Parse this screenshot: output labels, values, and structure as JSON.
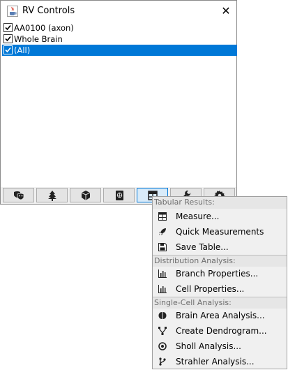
{
  "window": {
    "title": "RV Controls",
    "close_glyph": "✕",
    "icon": "java-cup-icon"
  },
  "tree": {
    "items": [
      {
        "label": "AA0100 (axon)",
        "checked": true,
        "selected": false
      },
      {
        "label": "Whole Brain",
        "checked": true,
        "selected": false
      },
      {
        "label": "(All)",
        "checked": true,
        "selected": true
      }
    ]
  },
  "toolbar": {
    "buttons": [
      {
        "icon": "masks-icon",
        "active": false
      },
      {
        "icon": "tree-icon",
        "active": false
      },
      {
        "icon": "cube-icon",
        "active": false
      },
      {
        "icon": "atlas-icon",
        "active": false
      },
      {
        "icon": "table-icon",
        "active": true
      },
      {
        "icon": "wrench-icon",
        "active": false
      },
      {
        "icon": "gear-icon",
        "active": false
      }
    ]
  },
  "menu": {
    "sections": [
      {
        "header": "Tabular Results:",
        "items": [
          {
            "label": "Measure...",
            "icon": "table-grid-icon"
          },
          {
            "label": "Quick Measurements",
            "icon": "rocket-icon"
          },
          {
            "label": "Save Table...",
            "icon": "save-icon"
          }
        ]
      },
      {
        "header": "Distribution Analysis:",
        "items": [
          {
            "label": "Branch Properties...",
            "icon": "bar-chart-icon"
          },
          {
            "label": "Cell Properties...",
            "icon": "bar-chart-icon"
          }
        ]
      },
      {
        "header": "Single-Cell Analysis:",
        "items": [
          {
            "label": "Brain Area Analysis...",
            "icon": "brain-icon"
          },
          {
            "label": "Create Dendrogram...",
            "icon": "dendrogram-icon"
          },
          {
            "label": "Sholl Analysis...",
            "icon": "bullseye-icon"
          },
          {
            "label": "Strahler Analysis...",
            "icon": "branch-icon"
          }
        ]
      }
    ]
  }
}
